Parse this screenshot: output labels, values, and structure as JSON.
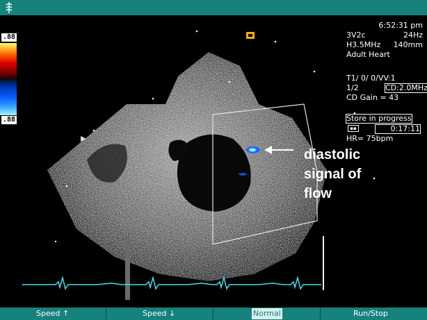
{
  "status": {
    "time": "6:52:31 pm",
    "probe": "3V2c",
    "frame_rate": "24Hz",
    "frequency": "H3.5MHz",
    "depth": "140mm",
    "preset": "Adult Heart",
    "settings_line1": "T1/ 0/ 0/VV:1",
    "settings_line2_left": "1/2",
    "cd_frequency": "CD:2.0MHz",
    "cd_gain": "CD Gain = 43",
    "store_status": "Store in progress",
    "store_timer": "0:17:11",
    "heart_rate": "HR= 75bpm"
  },
  "color_scale": {
    "max_label": ".88",
    "min_label": ".88",
    "positive_color": "#ff2200",
    "negative_color": "#1a6cff"
  },
  "annotation": {
    "line1": "diastolic",
    "line2": "signal of",
    "line3": "flow"
  },
  "footer": {
    "speed_up": "Speed ↑",
    "speed_down": "Speed ↓",
    "normal": "Normal",
    "run_stop": "Run/Stop"
  },
  "colors": {
    "chrome_teal": "#17817c",
    "ecg_trace": "#40e0f0",
    "text": "#ffffff"
  }
}
